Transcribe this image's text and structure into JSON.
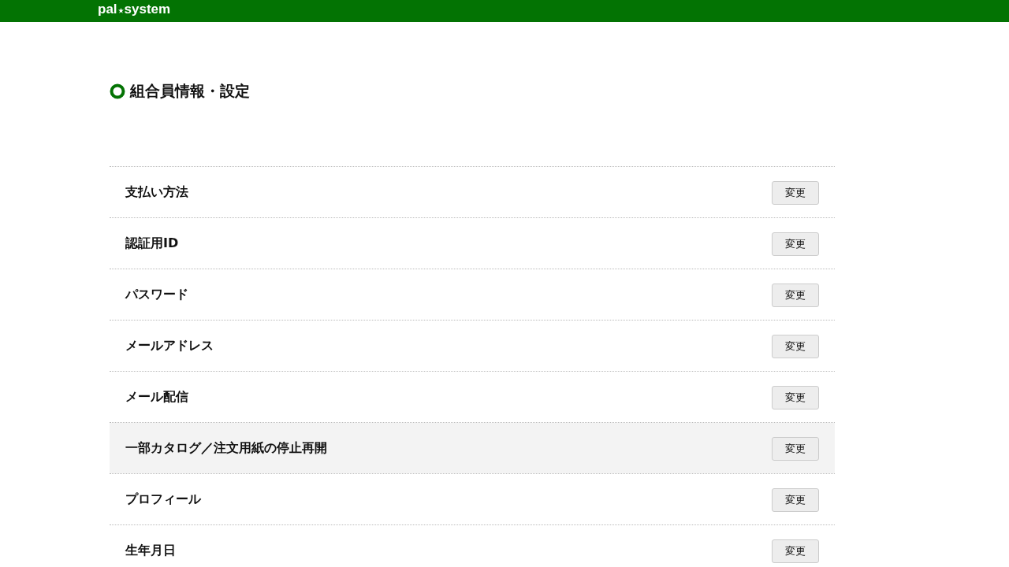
{
  "header": {
    "logo_left": "pal",
    "logo_right": "system"
  },
  "page_title": "組合員情報・設定",
  "settings": [
    {
      "label": "支払い方法",
      "button": "変更",
      "highlighted": false
    },
    {
      "label": "認証用ID",
      "button": "変更",
      "highlighted": false
    },
    {
      "label": "パスワード",
      "button": "変更",
      "highlighted": false
    },
    {
      "label": "メールアドレス",
      "button": "変更",
      "highlighted": false
    },
    {
      "label": "メール配信",
      "button": "変更",
      "highlighted": false
    },
    {
      "label": "一部カタログ／注文用紙の停止再開",
      "button": "変更",
      "highlighted": true
    },
    {
      "label": "プロフィール",
      "button": "変更",
      "highlighted": false
    },
    {
      "label": "生年月日",
      "button": "変更",
      "highlighted": false
    }
  ]
}
